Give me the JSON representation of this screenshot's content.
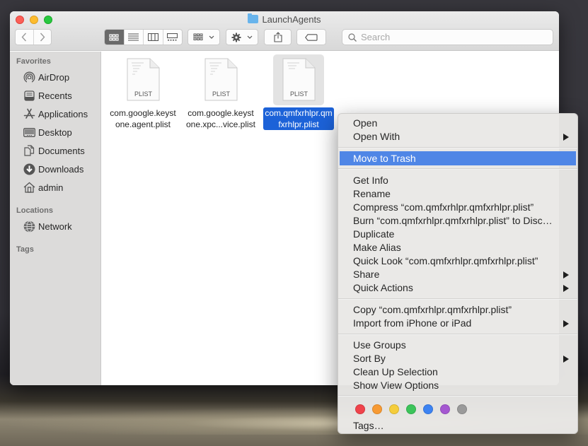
{
  "window": {
    "title": "LaunchAgents",
    "folder_icon": "folder-icon"
  },
  "toolbar": {
    "back_icon": "chevron-left-icon",
    "forward_icon": "chevron-right-icon",
    "view_modes": [
      {
        "name": "icon-view",
        "active": true
      },
      {
        "name": "list-view",
        "active": false
      },
      {
        "name": "column-view",
        "active": false
      },
      {
        "name": "gallery-view",
        "active": false
      }
    ],
    "group_icon": "group-by-icon",
    "action_icon": "gear-icon",
    "share_icon": "share-icon",
    "tag_icon": "tag-icon",
    "search": {
      "value": "",
      "placeholder": "Search"
    }
  },
  "sidebar": {
    "favorites_heading": "Favorites",
    "favorites": [
      {
        "label": "AirDrop",
        "icon": "airdrop-icon"
      },
      {
        "label": "Recents",
        "icon": "recents-icon"
      },
      {
        "label": "Applications",
        "icon": "applications-icon"
      },
      {
        "label": "Desktop",
        "icon": "desktop-icon"
      },
      {
        "label": "Documents",
        "icon": "documents-icon"
      },
      {
        "label": "Downloads",
        "icon": "downloads-icon"
      },
      {
        "label": "admin",
        "icon": "home-icon"
      }
    ],
    "locations_heading": "Locations",
    "locations": [
      {
        "label": "Network",
        "icon": "network-icon"
      }
    ],
    "tags_heading": "Tags"
  },
  "files": [
    {
      "name_line1": "com.google.keyst",
      "name_line2": "one.agent.plist",
      "type_label": "PLIST",
      "selected": false
    },
    {
      "name_line1": "com.google.keyst",
      "name_line2": "one.xpc...vice.plist",
      "type_label": "PLIST",
      "selected": false
    },
    {
      "name_line1": "com.qmfxrhlpr.qm",
      "name_line2": "fxrhlpr.plist",
      "type_label": "PLIST",
      "selected": true
    }
  ],
  "context_menu": {
    "items": [
      {
        "label": "Open",
        "submenu": false
      },
      {
        "label": "Open With",
        "submenu": true
      },
      {
        "label": "Move to Trash",
        "submenu": false,
        "highlighted": true
      },
      {
        "label": "Get Info",
        "submenu": false
      },
      {
        "label": "Rename",
        "submenu": false
      },
      {
        "label": "Compress “com.qmfxrhlpr.qmfxrhlpr.plist”",
        "submenu": false
      },
      {
        "label": "Burn “com.qmfxrhlpr.qmfxrhlpr.plist” to Disc…",
        "submenu": false
      },
      {
        "label": "Duplicate",
        "submenu": false
      },
      {
        "label": "Make Alias",
        "submenu": false
      },
      {
        "label": "Quick Look “com.qmfxrhlpr.qmfxrhlpr.plist”",
        "submenu": false
      },
      {
        "label": "Share",
        "submenu": true
      },
      {
        "label": "Quick Actions",
        "submenu": true
      },
      {
        "label": "Copy “com.qmfxrhlpr.qmfxrhlpr.plist”",
        "submenu": false
      },
      {
        "label": "Import from iPhone or iPad",
        "submenu": true
      },
      {
        "label": "Use Groups",
        "submenu": false
      },
      {
        "label": "Sort By",
        "submenu": true
      },
      {
        "label": "Clean Up Selection",
        "submenu": false
      },
      {
        "label": "Show View Options",
        "submenu": false
      },
      {
        "label": "Tags…",
        "submenu": false
      }
    ],
    "tag_colors": [
      {
        "name": "red",
        "color": "#f0434b"
      },
      {
        "name": "orange",
        "color": "#f79a33"
      },
      {
        "name": "yellow",
        "color": "#f5cd3b"
      },
      {
        "name": "green",
        "color": "#3cc45a"
      },
      {
        "name": "blue",
        "color": "#3d83f2"
      },
      {
        "name": "purple",
        "color": "#a558d1"
      },
      {
        "name": "gray",
        "color": "#9a9a9a"
      }
    ]
  },
  "colors": {
    "selection": "#1c62d8",
    "menu_highlight": "#4f86e6"
  }
}
